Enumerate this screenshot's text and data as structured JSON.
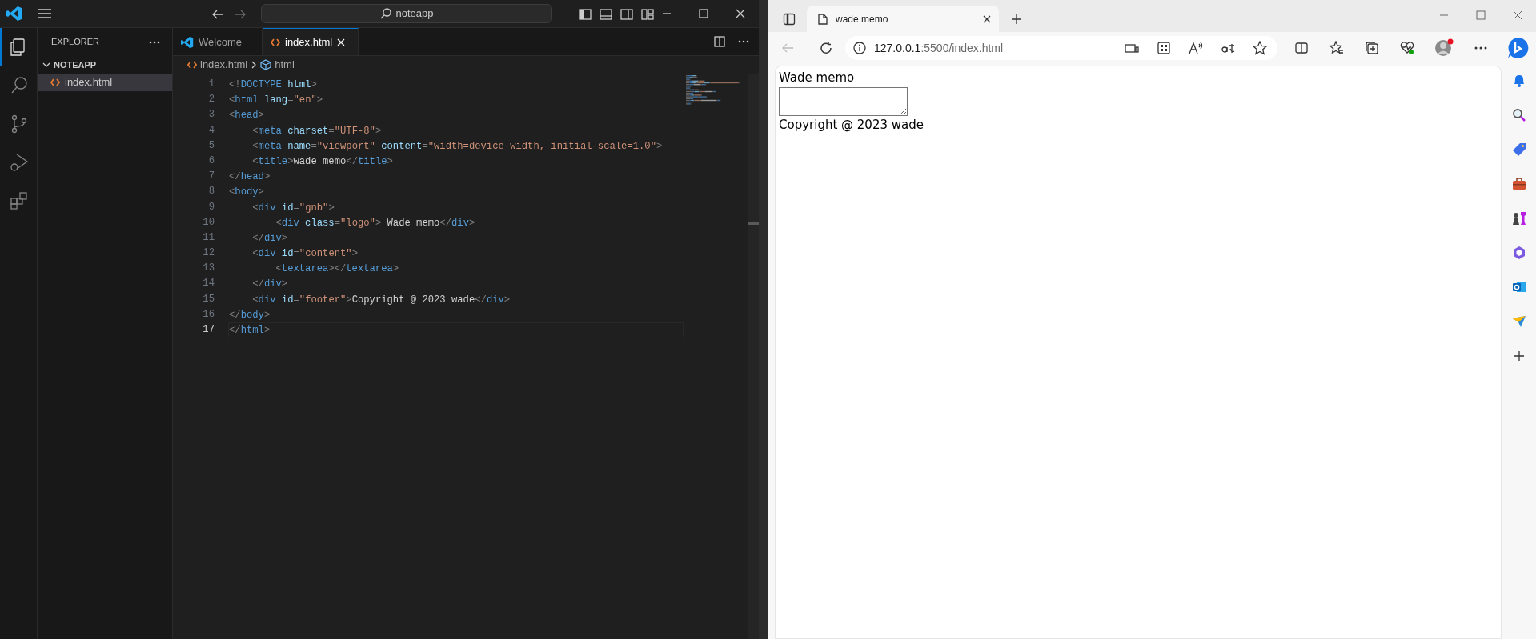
{
  "vscode": {
    "title_bar": {
      "search": "noteapp"
    },
    "activity_bar": [
      {
        "kind": "explorer",
        "selected": true
      },
      {
        "kind": "search",
        "selected": false
      },
      {
        "kind": "source-control",
        "selected": false
      },
      {
        "kind": "run-debug",
        "selected": false
      },
      {
        "kind": "extensions",
        "selected": false
      }
    ],
    "sidebar": {
      "title": "EXPLORER",
      "folder": {
        "name": "NOTEAPP",
        "expanded": true,
        "children": [
          {
            "name": "index.html",
            "selected": true
          }
        ]
      }
    },
    "tabs": [
      {
        "kind": "welcome",
        "label": "Welcome",
        "selected": false
      },
      {
        "kind": "html",
        "label": "index.html",
        "selected": true
      }
    ],
    "breadcrumb": [
      {
        "kind": "html-file",
        "label": "index.html"
      },
      {
        "kind": "element",
        "label": "html"
      }
    ],
    "lines": [
      {
        "number": "1",
        "current": false,
        "tokens": [
          {
            "kind": "p",
            "text": "<!"
          },
          {
            "kind": "tag",
            "text": "DOCTYPE"
          },
          {
            "kind": "attr",
            "text": " html"
          },
          {
            "kind": "p",
            "text": ">"
          }
        ]
      },
      {
        "number": "2",
        "current": false,
        "tokens": [
          {
            "kind": "p",
            "text": "<"
          },
          {
            "kind": "tag",
            "text": "html"
          },
          {
            "kind": "attr",
            "text": " lang"
          },
          {
            "kind": "p",
            "text": "="
          },
          {
            "kind": "str",
            "text": "\"en\""
          },
          {
            "kind": "p",
            "text": ">"
          }
        ]
      },
      {
        "number": "3",
        "current": false,
        "tokens": [
          {
            "kind": "p",
            "text": "<"
          },
          {
            "kind": "tag",
            "text": "head"
          },
          {
            "kind": "p",
            "text": ">"
          }
        ]
      },
      {
        "number": "4",
        "current": false,
        "tokens": [
          {
            "kind": "p",
            "text": "    <"
          },
          {
            "kind": "tag",
            "text": "meta"
          },
          {
            "kind": "attr",
            "text": " charset"
          },
          {
            "kind": "p",
            "text": "="
          },
          {
            "kind": "str",
            "text": "\"UTF-8\""
          },
          {
            "kind": "p",
            "text": ">"
          }
        ]
      },
      {
        "number": "5",
        "current": false,
        "tokens": [
          {
            "kind": "p",
            "text": "    <"
          },
          {
            "kind": "tag",
            "text": "meta"
          },
          {
            "kind": "attr",
            "text": " name"
          },
          {
            "kind": "p",
            "text": "="
          },
          {
            "kind": "str",
            "text": "\"viewport\""
          },
          {
            "kind": "attr",
            "text": " content"
          },
          {
            "kind": "p",
            "text": "="
          },
          {
            "kind": "str",
            "text": "\"width=device-width, initial-scale=1.0\""
          },
          {
            "kind": "p",
            "text": ">"
          }
        ]
      },
      {
        "number": "6",
        "current": false,
        "tokens": [
          {
            "kind": "p",
            "text": "    <"
          },
          {
            "kind": "tag",
            "text": "title"
          },
          {
            "kind": "p",
            "text": ">"
          },
          {
            "kind": "txt",
            "text": "wade memo"
          },
          {
            "kind": "p",
            "text": "</"
          },
          {
            "kind": "tag",
            "text": "title"
          },
          {
            "kind": "p",
            "text": ">"
          }
        ]
      },
      {
        "number": "7",
        "current": false,
        "tokens": [
          {
            "kind": "p",
            "text": "</"
          },
          {
            "kind": "tag",
            "text": "head"
          },
          {
            "kind": "p",
            "text": ">"
          }
        ]
      },
      {
        "number": "8",
        "current": false,
        "tokens": [
          {
            "kind": "p",
            "text": "<"
          },
          {
            "kind": "tag",
            "text": "body"
          },
          {
            "kind": "p",
            "text": ">"
          }
        ]
      },
      {
        "number": "9",
        "current": false,
        "tokens": [
          {
            "kind": "p",
            "text": "    <"
          },
          {
            "kind": "tag",
            "text": "div"
          },
          {
            "kind": "attr",
            "text": " id"
          },
          {
            "kind": "p",
            "text": "="
          },
          {
            "kind": "str",
            "text": "\"gnb\""
          },
          {
            "kind": "p",
            "text": ">"
          }
        ]
      },
      {
        "number": "10",
        "current": false,
        "tokens": [
          {
            "kind": "p",
            "text": "        <"
          },
          {
            "kind": "tag",
            "text": "div"
          },
          {
            "kind": "attr",
            "text": " class"
          },
          {
            "kind": "p",
            "text": "="
          },
          {
            "kind": "str",
            "text": "\"logo\""
          },
          {
            "kind": "p",
            "text": ">"
          },
          {
            "kind": "txt",
            "text": " Wade memo"
          },
          {
            "kind": "p",
            "text": "</"
          },
          {
            "kind": "tag",
            "text": "div"
          },
          {
            "kind": "p",
            "text": ">"
          }
        ]
      },
      {
        "number": "11",
        "current": false,
        "tokens": [
          {
            "kind": "p",
            "text": "    </"
          },
          {
            "kind": "tag",
            "text": "div"
          },
          {
            "kind": "p",
            "text": ">"
          }
        ]
      },
      {
        "number": "12",
        "current": false,
        "tokens": [
          {
            "kind": "p",
            "text": "    <"
          },
          {
            "kind": "tag",
            "text": "div"
          },
          {
            "kind": "attr",
            "text": " id"
          },
          {
            "kind": "p",
            "text": "="
          },
          {
            "kind": "str",
            "text": "\"content\""
          },
          {
            "kind": "p",
            "text": ">"
          }
        ]
      },
      {
        "number": "13",
        "current": false,
        "tokens": [
          {
            "kind": "p",
            "text": "        <"
          },
          {
            "kind": "tag",
            "text": "textarea"
          },
          {
            "kind": "p",
            "text": "></"
          },
          {
            "kind": "tag",
            "text": "textarea"
          },
          {
            "kind": "p",
            "text": ">"
          }
        ]
      },
      {
        "number": "14",
        "current": false,
        "tokens": [
          {
            "kind": "p",
            "text": "    </"
          },
          {
            "kind": "tag",
            "text": "div"
          },
          {
            "kind": "p",
            "text": ">"
          }
        ]
      },
      {
        "number": "15",
        "current": false,
        "tokens": [
          {
            "kind": "p",
            "text": "    <"
          },
          {
            "kind": "tag",
            "text": "div"
          },
          {
            "kind": "attr",
            "text": " id"
          },
          {
            "kind": "p",
            "text": "="
          },
          {
            "kind": "str",
            "text": "\"footer\""
          },
          {
            "kind": "p",
            "text": ">"
          },
          {
            "kind": "txt",
            "text": "Copyright @ 2023 wade"
          },
          {
            "kind": "p",
            "text": "</"
          },
          {
            "kind": "tag",
            "text": "div"
          },
          {
            "kind": "p",
            "text": ">"
          }
        ]
      },
      {
        "number": "16",
        "current": false,
        "tokens": [
          {
            "kind": "p",
            "text": "</"
          },
          {
            "kind": "tag",
            "text": "body"
          },
          {
            "kind": "p",
            "text": ">"
          }
        ]
      },
      {
        "number": "17",
        "current": true,
        "tokens": [
          {
            "kind": "p",
            "text": "</"
          },
          {
            "kind": "tag",
            "text": "html"
          },
          {
            "kind": "p",
            "text": ">"
          }
        ]
      }
    ]
  },
  "browser": {
    "tab": {
      "title": "wade memo"
    },
    "back": {
      "disabled": true
    },
    "url": {
      "host": "127.0.0.1",
      "path": ":5500/index.html"
    },
    "page": {
      "logo": "Wade memo",
      "footer": "Copyright @ 2023 wade"
    }
  }
}
